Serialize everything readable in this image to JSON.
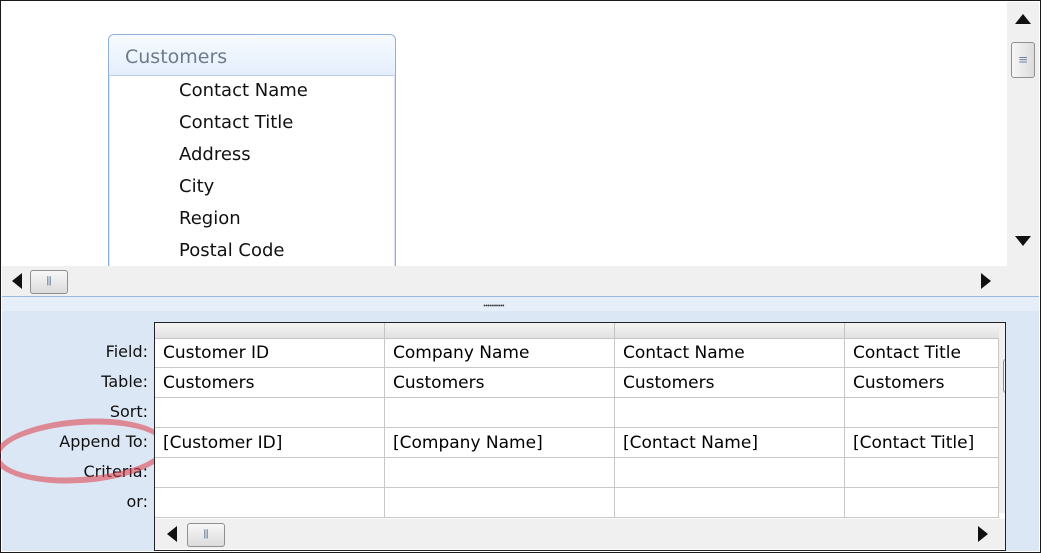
{
  "design_pane": {
    "table": {
      "title": "Customers",
      "fields": [
        "Contact Name",
        "Contact Title",
        "Address",
        "City",
        "Region",
        "Postal Code"
      ]
    }
  },
  "grid": {
    "row_labels": [
      "Field:",
      "Table:",
      "Sort:",
      "Append To:",
      "Criteria:",
      "or:"
    ],
    "columns": [
      {
        "field": "Customer ID",
        "table": "Customers",
        "sort": "",
        "append_to": "[Customer ID]",
        "criteria": "",
        "or": ""
      },
      {
        "field": "Company Name",
        "table": "Customers",
        "sort": "",
        "append_to": "[Company Name]",
        "criteria": "",
        "or": ""
      },
      {
        "field": "Contact Name",
        "table": "Customers",
        "sort": "",
        "append_to": "[Contact Name]",
        "criteria": "",
        "or": ""
      },
      {
        "field": "Contact Title",
        "table": "Customers",
        "sort": "",
        "append_to": "[Contact Title]",
        "criteria": "",
        "or": ""
      }
    ]
  },
  "colors": {
    "lower_pane_bg": "#dce7f5",
    "highlight": "#dc3c46"
  }
}
